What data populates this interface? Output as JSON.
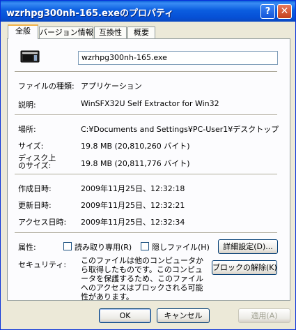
{
  "window": {
    "title": "wzrhpg300nh-165.exeのプロパティ",
    "help_glyph": "?",
    "close_glyph": "✕"
  },
  "tabs": [
    "全般",
    "バージョン情報",
    "互換性",
    "概要"
  ],
  "file": {
    "name": "wzrhpg300nh-165.exe"
  },
  "rows": {
    "type": {
      "label": "ファイルの種類:",
      "value": "アプリケーション"
    },
    "description": {
      "label": "説明:",
      "value": "WinSFX32U Self Extractor for Win32"
    },
    "location": {
      "label": "場所:",
      "value": "C:¥Documents and Settings¥PC-User1¥デスクトップ"
    },
    "size": {
      "label": "サイズ:",
      "value": "19.8 MB (20,810,260 バイト)"
    },
    "disk_size": {
      "label_line1": "ディスク上",
      "label_line2": "のサイズ:",
      "value": "19.8 MB (20,811,776 バイト)"
    },
    "created": {
      "label": "作成日時:",
      "value": "2009年11月25日、12:32:18"
    },
    "modified": {
      "label": "更新日時:",
      "value": "2009年11月25日、12:32:21"
    },
    "accessed": {
      "label": "アクセス日時:",
      "value": "2009年11月25日、12:32:34"
    }
  },
  "attributes": {
    "label": "属性:",
    "readonly": "読み取り専用(R)",
    "hidden": "隠しファイル(H)",
    "advanced_button": "詳細設定(D)..."
  },
  "security": {
    "label": "セキュリティ:",
    "text": "このファイルは他のコンピュータから取得したものです。このコンピュータを保護するため、このファイルへのアクセスはブロックされる可能性があります。",
    "unblock_button": "ブロックの解除(K)"
  },
  "buttons": {
    "ok": "OK",
    "cancel": "キャンセル",
    "apply": "適用(A)"
  }
}
